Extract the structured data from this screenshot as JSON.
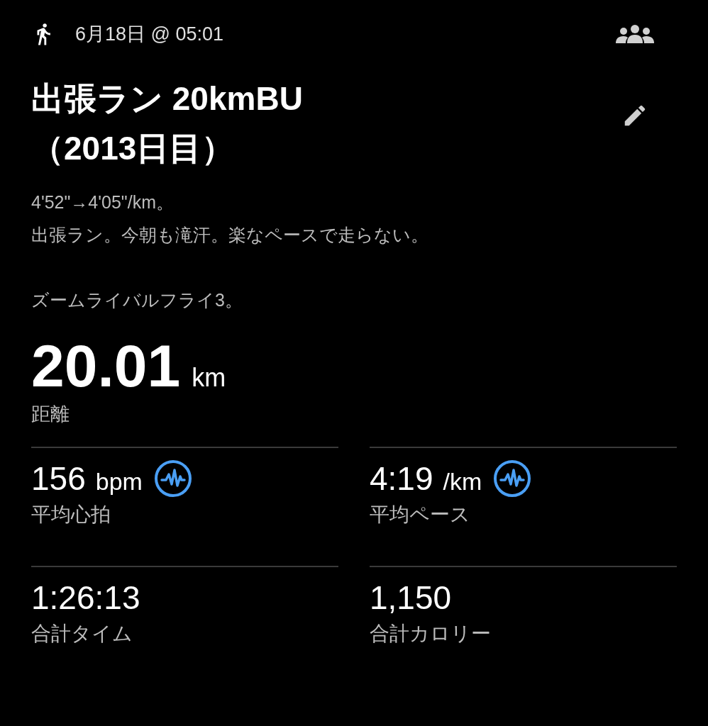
{
  "header": {
    "date": "6月18日 @ 05:01"
  },
  "title": [
    "出張ラン 20kmBU",
    "（2013日目）"
  ],
  "description": [
    [
      "4'52\"→4'05\"/km。",
      "出張ラン。今朝も滝汗。楽なペースで走らない。"
    ],
    [
      "ズームライバルフライ3。"
    ]
  ],
  "distance": {
    "value": "20.01",
    "unit": "km",
    "label": "距離"
  },
  "stats": [
    {
      "value": "156",
      "unit": "bpm",
      "label": "平均心拍",
      "kind": "graph"
    },
    {
      "value": "4:19",
      "unit": "/km",
      "label": "平均ペース",
      "kind": "graph"
    },
    {
      "value": "1:26:13",
      "label": "合計タイム",
      "kind": "plain"
    },
    {
      "value": "1,150",
      "label": "合計カロリー",
      "kind": "plain"
    }
  ]
}
